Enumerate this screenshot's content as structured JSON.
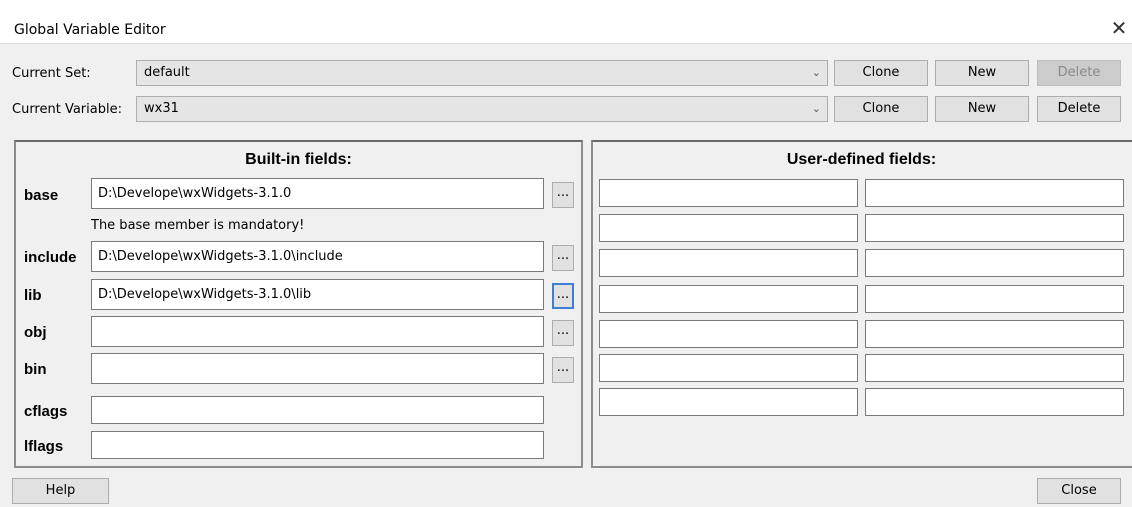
{
  "window": {
    "title": "Global Variable Editor",
    "close_glyph": "✕"
  },
  "current_set": {
    "label": "Current Set:",
    "value": "default",
    "clone": "Clone",
    "new": "New",
    "delete": "Delete"
  },
  "current_variable": {
    "label": "Current Variable:",
    "value": "wx31",
    "clone": "Clone",
    "new": "New",
    "delete": "Delete"
  },
  "builtin": {
    "heading": "Built-in fields:",
    "note": "The base member is mandatory!",
    "browse_label": "...",
    "fields": [
      {
        "name": "base",
        "value": "D:\\Develope\\wxWidgets-3.1.0"
      },
      {
        "name": "include",
        "value": "D:\\Develope\\wxWidgets-3.1.0\\include"
      },
      {
        "name": "lib",
        "value": "D:\\Develope\\wxWidgets-3.1.0\\lib"
      },
      {
        "name": "obj",
        "value": ""
      },
      {
        "name": "bin",
        "value": ""
      },
      {
        "name": "cflags",
        "value": ""
      },
      {
        "name": "lflags",
        "value": ""
      }
    ]
  },
  "user_defined": {
    "heading": "User-defined fields:",
    "rows": [
      {
        "key": "",
        "value": ""
      },
      {
        "key": "",
        "value": ""
      },
      {
        "key": "",
        "value": ""
      },
      {
        "key": "",
        "value": ""
      },
      {
        "key": "",
        "value": ""
      },
      {
        "key": "",
        "value": ""
      },
      {
        "key": "",
        "value": ""
      }
    ]
  },
  "footer": {
    "help": "Help",
    "close": "Close"
  }
}
